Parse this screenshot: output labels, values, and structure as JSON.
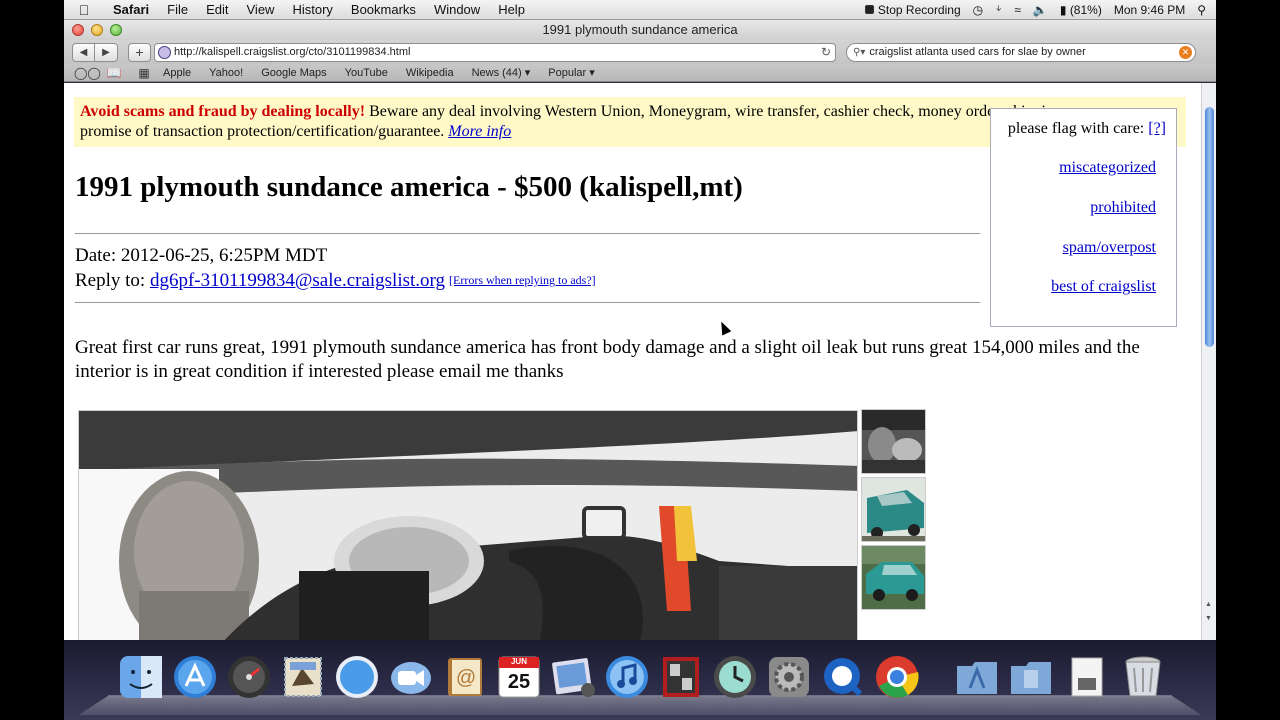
{
  "menubar": {
    "app": "Safari",
    "items": [
      "File",
      "Edit",
      "View",
      "History",
      "Bookmarks",
      "Window",
      "Help"
    ],
    "recording": "Stop Recording",
    "battery": "(81%)",
    "clock": "Mon 9:46 PM"
  },
  "window": {
    "title": "1991 plymouth sundance america"
  },
  "toolbar": {
    "url": "http://kalispell.craigslist.org/cto/3101199834.html",
    "search": "craigslist atlanta used cars for slae by owner"
  },
  "bookmarks": [
    "Apple",
    "Yahoo!",
    "Google Maps",
    "YouTube",
    "Wikipedia",
    "News (44) ▾",
    "Popular ▾"
  ],
  "page": {
    "warning_bold": "Avoid scams and fraud by dealing locally!",
    "warning_text": " Beware any deal involving Western Union, Moneygram, wire transfer, cashier check, money order, shipping, escrow, or any promise of transaction protection/certification/guarantee. ",
    "warning_link": "More info",
    "flag": {
      "heading": "please flag with care:",
      "help": "[?]",
      "links": [
        "miscategorized",
        "prohibited",
        "spam/overpost",
        "best of craigslist"
      ]
    },
    "title": "1991 plymouth sundance america - $500 (kalispell,mt)",
    "date": "Date: 2012-06-25, 6:25PM MDT",
    "reply_label": "Reply to: ",
    "reply_email": "dg6pf-3101199834@sale.craigslist.org",
    "reply_errors": "[Errors when replying to ads?]",
    "body": "Great first car runs great, 1991 plymouth sundance america has front body damage and a slight oil leak but runs great 154,000 miles and the interior is in great condition if interested please email me thanks"
  },
  "dock": {
    "calendar_month": "JUN",
    "calendar_day": "25"
  }
}
